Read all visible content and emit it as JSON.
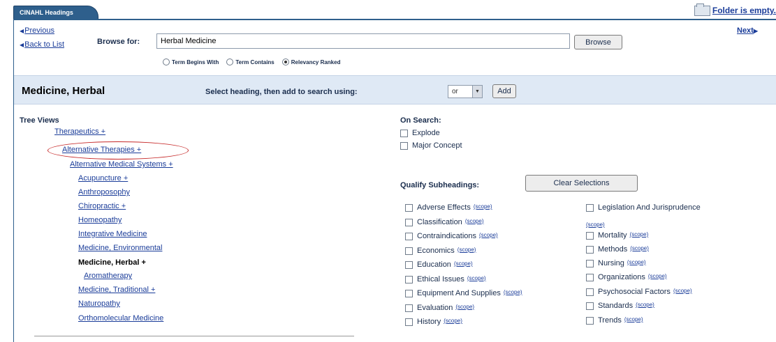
{
  "header": {
    "tab_label": "CINAHL Headings",
    "folder_text": "Folder is empty."
  },
  "nav": {
    "previous": "Previous",
    "back": "Back to List",
    "next": "Next"
  },
  "browse": {
    "label": "Browse for:",
    "value": "Herbal Medicine",
    "button": "Browse",
    "options": [
      "Term Begins With",
      "Term Contains",
      "Relevancy Ranked"
    ],
    "selected": "Relevancy Ranked"
  },
  "heading": {
    "title": "Medicine, Herbal",
    "select_label": "Select heading, then add to search using:",
    "operator": "or",
    "add_button": "Add"
  },
  "tree": {
    "title": "Tree Views",
    "items": [
      {
        "label": "Therapeutics +"
      },
      {
        "label": "Alternative Therapies +",
        "circled": true
      },
      {
        "label": "Alternative Medical Systems +"
      },
      {
        "label": "Acupuncture +"
      },
      {
        "label": "Anthroposophy"
      },
      {
        "label": "Chiropractic +"
      },
      {
        "label": "Homeopathy"
      },
      {
        "label": "Integrative Medicine"
      },
      {
        "label": "Medicine, Environmental"
      },
      {
        "label": "Medicine, Herbal +",
        "current": true
      },
      {
        "label": "Aromatherapy"
      },
      {
        "label": "Medicine, Traditional +"
      },
      {
        "label": "Naturopathy"
      },
      {
        "label": "Orthomolecular Medicine"
      }
    ]
  },
  "on_search": {
    "title": "On Search:",
    "options": [
      "Explode",
      "Major Concept"
    ]
  },
  "qualify": {
    "label": "Qualify Subheadings:",
    "clear_button": "Clear Selections",
    "scope_text": "(scope)",
    "left": [
      "Adverse Effects",
      "Classification",
      "Contraindications",
      "Economics",
      "Education",
      "Ethical Issues",
      "Equipment And Supplies",
      "Evaluation",
      "History"
    ],
    "right": [
      "Legislation And Jurisprudence",
      "Mortality",
      "Methods",
      "Nursing",
      "Organizations",
      "Psychosocial Factors",
      "Standards",
      "Trends"
    ]
  }
}
